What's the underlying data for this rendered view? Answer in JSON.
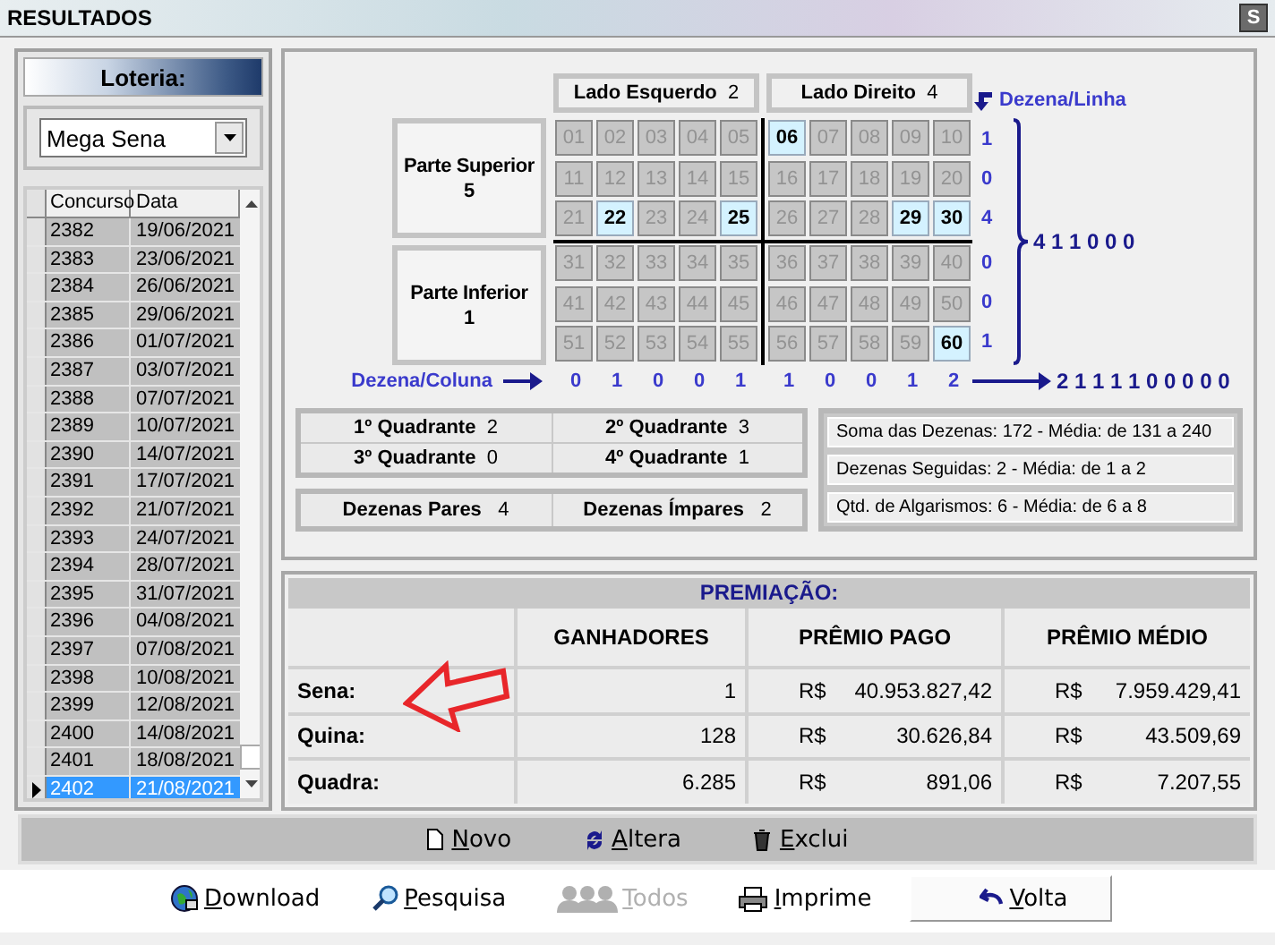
{
  "window": {
    "title": "RESULTADOS",
    "corner_glyph": "S"
  },
  "lottery": {
    "label": "Loteria:",
    "value": "Mega Sena"
  },
  "draws": {
    "columns": [
      "Concurso",
      "Data"
    ],
    "rows": [
      {
        "concurso": "2382",
        "data": "19/06/2021",
        "selected": false
      },
      {
        "concurso": "2383",
        "data": "23/06/2021",
        "selected": false
      },
      {
        "concurso": "2384",
        "data": "26/06/2021",
        "selected": false
      },
      {
        "concurso": "2385",
        "data": "29/06/2021",
        "selected": false
      },
      {
        "concurso": "2386",
        "data": "01/07/2021",
        "selected": false
      },
      {
        "concurso": "2387",
        "data": "03/07/2021",
        "selected": false
      },
      {
        "concurso": "2388",
        "data": "07/07/2021",
        "selected": false
      },
      {
        "concurso": "2389",
        "data": "10/07/2021",
        "selected": false
      },
      {
        "concurso": "2390",
        "data": "14/07/2021",
        "selected": false
      },
      {
        "concurso": "2391",
        "data": "17/07/2021",
        "selected": false
      },
      {
        "concurso": "2392",
        "data": "21/07/2021",
        "selected": false
      },
      {
        "concurso": "2393",
        "data": "24/07/2021",
        "selected": false
      },
      {
        "concurso": "2394",
        "data": "28/07/2021",
        "selected": false
      },
      {
        "concurso": "2395",
        "data": "31/07/2021",
        "selected": false
      },
      {
        "concurso": "2396",
        "data": "04/08/2021",
        "selected": false
      },
      {
        "concurso": "2397",
        "data": "07/08/2021",
        "selected": false
      },
      {
        "concurso": "2398",
        "data": "10/08/2021",
        "selected": false
      },
      {
        "concurso": "2399",
        "data": "12/08/2021",
        "selected": false
      },
      {
        "concurso": "2400",
        "data": "14/08/2021",
        "selected": false
      },
      {
        "concurso": "2401",
        "data": "18/08/2021",
        "selected": false
      },
      {
        "concurso": "2402",
        "data": "21/08/2021",
        "selected": true
      }
    ]
  },
  "sides": [
    {
      "label": "Lado Esquerdo",
      "value": "2"
    },
    {
      "label": "Lado Direito",
      "value": "4"
    }
  ],
  "halves": [
    {
      "label": "Parte Superior",
      "value": "5"
    },
    {
      "label": "Parte Inferior",
      "value": "1"
    }
  ],
  "numbers": [
    {
      "n": "01",
      "selected": false
    },
    {
      "n": "02",
      "selected": false
    },
    {
      "n": "03",
      "selected": false
    },
    {
      "n": "04",
      "selected": false
    },
    {
      "n": "05",
      "selected": false
    },
    {
      "n": "06",
      "selected": true
    },
    {
      "n": "07",
      "selected": false
    },
    {
      "n": "08",
      "selected": false
    },
    {
      "n": "09",
      "selected": false
    },
    {
      "n": "10",
      "selected": false
    },
    {
      "n": "11",
      "selected": false
    },
    {
      "n": "12",
      "selected": false
    },
    {
      "n": "13",
      "selected": false
    },
    {
      "n": "14",
      "selected": false
    },
    {
      "n": "15",
      "selected": false
    },
    {
      "n": "16",
      "selected": false
    },
    {
      "n": "17",
      "selected": false
    },
    {
      "n": "18",
      "selected": false
    },
    {
      "n": "19",
      "selected": false
    },
    {
      "n": "20",
      "selected": false
    },
    {
      "n": "21",
      "selected": false
    },
    {
      "n": "22",
      "selected": true
    },
    {
      "n": "23",
      "selected": false
    },
    {
      "n": "24",
      "selected": false
    },
    {
      "n": "25",
      "selected": true
    },
    {
      "n": "26",
      "selected": false
    },
    {
      "n": "27",
      "selected": false
    },
    {
      "n": "28",
      "selected": false
    },
    {
      "n": "29",
      "selected": true
    },
    {
      "n": "30",
      "selected": true
    },
    {
      "n": "31",
      "selected": false
    },
    {
      "n": "32",
      "selected": false
    },
    {
      "n": "33",
      "selected": false
    },
    {
      "n": "34",
      "selected": false
    },
    {
      "n": "35",
      "selected": false
    },
    {
      "n": "36",
      "selected": false
    },
    {
      "n": "37",
      "selected": false
    },
    {
      "n": "38",
      "selected": false
    },
    {
      "n": "39",
      "selected": false
    },
    {
      "n": "40",
      "selected": false
    },
    {
      "n": "41",
      "selected": false
    },
    {
      "n": "42",
      "selected": false
    },
    {
      "n": "43",
      "selected": false
    },
    {
      "n": "44",
      "selected": false
    },
    {
      "n": "45",
      "selected": false
    },
    {
      "n": "46",
      "selected": false
    },
    {
      "n": "47",
      "selected": false
    },
    {
      "n": "48",
      "selected": false
    },
    {
      "n": "49",
      "selected": false
    },
    {
      "n": "50",
      "selected": false
    },
    {
      "n": "51",
      "selected": false
    },
    {
      "n": "52",
      "selected": false
    },
    {
      "n": "53",
      "selected": false
    },
    {
      "n": "54",
      "selected": false
    },
    {
      "n": "55",
      "selected": false
    },
    {
      "n": "56",
      "selected": false
    },
    {
      "n": "57",
      "selected": false
    },
    {
      "n": "58",
      "selected": false
    },
    {
      "n": "59",
      "selected": false
    },
    {
      "n": "60",
      "selected": true
    }
  ],
  "row_label": "Dezena/Linha",
  "row_counts": [
    "1",
    "0",
    "4",
    "0",
    "0",
    "1"
  ],
  "row_summary": "4 1 1 0 0 0",
  "column_label": "Dezena/Coluna",
  "column_counts": [
    "0",
    "1",
    "0",
    "0",
    "1",
    "1",
    "0",
    "0",
    "1",
    "2"
  ],
  "column_summary": "2 1 1 1 1 0 0 0 0 0",
  "quadrants": [
    {
      "label": "1º Quadrante",
      "value": "2"
    },
    {
      "label": "2º Quadrante",
      "value": "3"
    },
    {
      "label": "3º Quadrante",
      "value": "0"
    },
    {
      "label": "4º Quadrante",
      "value": "1"
    }
  ],
  "parity": [
    {
      "label": "Dezenas Pares",
      "value": "4"
    },
    {
      "label": "Dezenas Ímpares",
      "value": "2"
    }
  ],
  "stats": [
    "Soma das Dezenas: 172 - Média: de 131 a 240",
    "Dezenas Seguidas: 2 - Média: de 1 a 2",
    "Qtd. de Algarismos: 6 - Média: de 6 a 8"
  ],
  "prizes": {
    "title": "PREMIAÇÃO:",
    "columns": [
      "GANHADORES",
      "PRÊMIO PAGO",
      "PRÊMIO MÉDIO"
    ],
    "rows": [
      {
        "label": "Sena:",
        "winners": "1",
        "paid_currency": "R$",
        "paid": "40.953.827,42",
        "avg_currency": "R$",
        "avg": "7.959.429,41"
      },
      {
        "label": "Quina:",
        "winners": "128",
        "paid_currency": "R$",
        "paid": "30.626,84",
        "avg_currency": "R$",
        "avg": "43.509,69"
      },
      {
        "label": "Quadra:",
        "winners": "6.285",
        "paid_currency": "R$",
        "paid": "891,06",
        "avg_currency": "R$",
        "avg": "7.207,55"
      }
    ]
  },
  "actions": [
    {
      "kind": "new",
      "label": "Novo"
    },
    {
      "kind": "edit",
      "label": "Altera"
    },
    {
      "kind": "delete",
      "label": "Exclui"
    }
  ],
  "toolbar": [
    {
      "kind": "download",
      "label": "Download",
      "disabled": false,
      "focused": false
    },
    {
      "kind": "search",
      "label": "Pesquisa",
      "disabled": false,
      "focused": false
    },
    {
      "kind": "all",
      "label": "Todos",
      "disabled": true,
      "focused": false
    },
    {
      "kind": "print",
      "label": "Imprime",
      "disabled": false,
      "focused": false
    },
    {
      "kind": "back",
      "label": "Volta",
      "disabled": false,
      "focused": true
    }
  ],
  "annotation": {
    "kind": "arrow",
    "color": "#e8262a"
  }
}
